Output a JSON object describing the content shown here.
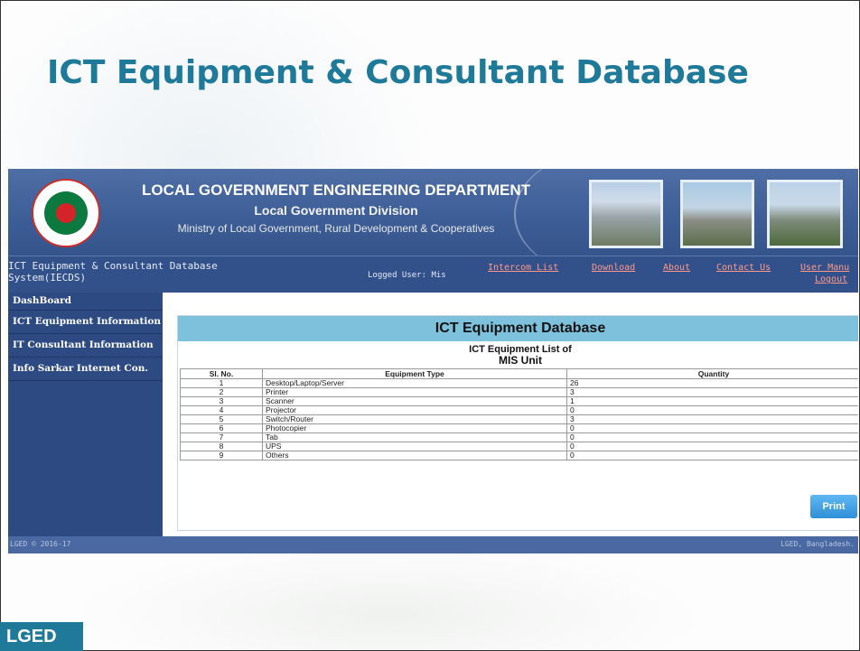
{
  "slide": {
    "title": "ICT Equipment & Consultant Database",
    "footer_label": "LGED"
  },
  "banner": {
    "title": "LOCAL GOVERNMENT ENGINEERING DEPARTMENT",
    "subtitle": "Local Government Division",
    "ministry": "Ministry of Local Government, Rural Development & Cooperatives"
  },
  "navbar": {
    "system_title": "ICT Equipment & Consultant Database System(IECDS)",
    "logged_user": "Logged User: Mis",
    "links": {
      "intercom": "Intercom List",
      "download": "Download",
      "about": "About",
      "contact": "Contact Us",
      "manual": "User Manu",
      "logout": "Logout"
    }
  },
  "sidebar": {
    "items": [
      "DashBoard",
      "ICT Equipment Information",
      "IT Consultant Information",
      "Info Sarkar Internet Con."
    ]
  },
  "panel": {
    "heading": "ICT Equipment Database",
    "list_title": "ICT Equipment List of",
    "unit": "MIS Unit",
    "columns": [
      "Sl. No.",
      "Equipment Type",
      "Quantity"
    ],
    "rows": [
      [
        "1",
        "Desktop/Laptop/Server",
        "26"
      ],
      [
        "2",
        "Printer",
        "3"
      ],
      [
        "3",
        "Scanner",
        "1"
      ],
      [
        "4",
        "Projector",
        "0"
      ],
      [
        "5",
        "Switch/Router",
        "3"
      ],
      [
        "6",
        "Photocopier",
        "0"
      ],
      [
        "7",
        "Tab",
        "0"
      ],
      [
        "8",
        "UPS",
        "0"
      ],
      [
        "9",
        "Others",
        "0"
      ]
    ],
    "print_label": "Print"
  },
  "footer": {
    "left": "LGED © 2016-17",
    "right": "LGED, Bangladesh."
  },
  "colors": {
    "title_teal": "#1f7a9a",
    "banner_blue": "#3e5e97",
    "nav_blue": "#32508a",
    "link_red": "#ff9a8a",
    "panel_head": "#7ec1dd",
    "print_blue": "#2f8fd6"
  }
}
